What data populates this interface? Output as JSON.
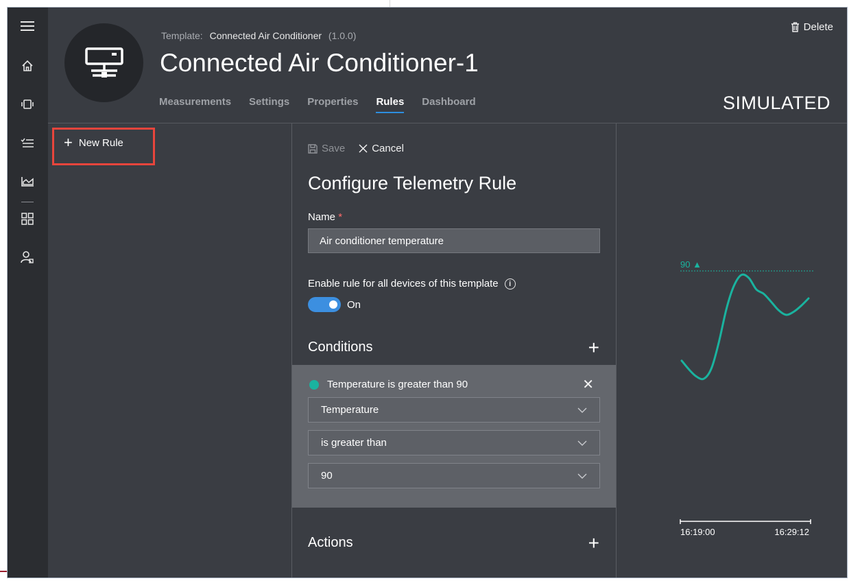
{
  "rail": {
    "icons": [
      "menu-icon",
      "home-icon",
      "devices-icon",
      "rules-list-icon",
      "analytics-icon",
      "dashboard-grid-icon",
      "admin-user-icon"
    ]
  },
  "header": {
    "template_prefix": "Template:",
    "template_name": "Connected Air Conditioner",
    "template_version": "(1.0.0)",
    "device_name": "Connected Air Conditioner-1",
    "delete_label": "Delete",
    "simulated_label": "SIMULATED",
    "tabs": [
      {
        "label": "Measurements",
        "active": false
      },
      {
        "label": "Settings",
        "active": false
      },
      {
        "label": "Properties",
        "active": false
      },
      {
        "label": "Rules",
        "active": true
      },
      {
        "label": "Dashboard",
        "active": false
      }
    ]
  },
  "rules": {
    "new_rule_label": "New Rule"
  },
  "config": {
    "save_label": "Save",
    "cancel_label": "Cancel",
    "title": "Configure Telemetry Rule",
    "name_label": "Name",
    "required_mark": "*",
    "name_value": "Air conditioner temperature",
    "enable_label": "Enable rule for all devices of this template",
    "toggle_on": true,
    "toggle_label": "On",
    "conditions_label": "Conditions",
    "condition": {
      "summary": "Temperature is greater than 90",
      "measurement": "Temperature",
      "operator": "is greater than",
      "value": "90",
      "dot_color": "#1ab39f"
    },
    "actions_label": "Actions"
  },
  "chart_data": {
    "type": "line",
    "threshold": 90,
    "threshold_label": "90 ▲",
    "x_tick_labels": [
      "16:19:00",
      "16:29:12"
    ],
    "color": "#1ab39f",
    "series": [
      {
        "values": [
          72.0,
          70.2,
          68.8,
          68.4,
          70.5,
          75.8,
          82.4,
          87.0,
          89.2,
          88.6,
          86.3,
          85.4,
          83.8,
          82.1,
          81.2,
          81.8,
          83.0,
          84.5
        ]
      }
    ]
  },
  "colors": {
    "accent": "#2d8fe0",
    "highlight_border": "#e8453c",
    "teal": "#1ab39f"
  }
}
